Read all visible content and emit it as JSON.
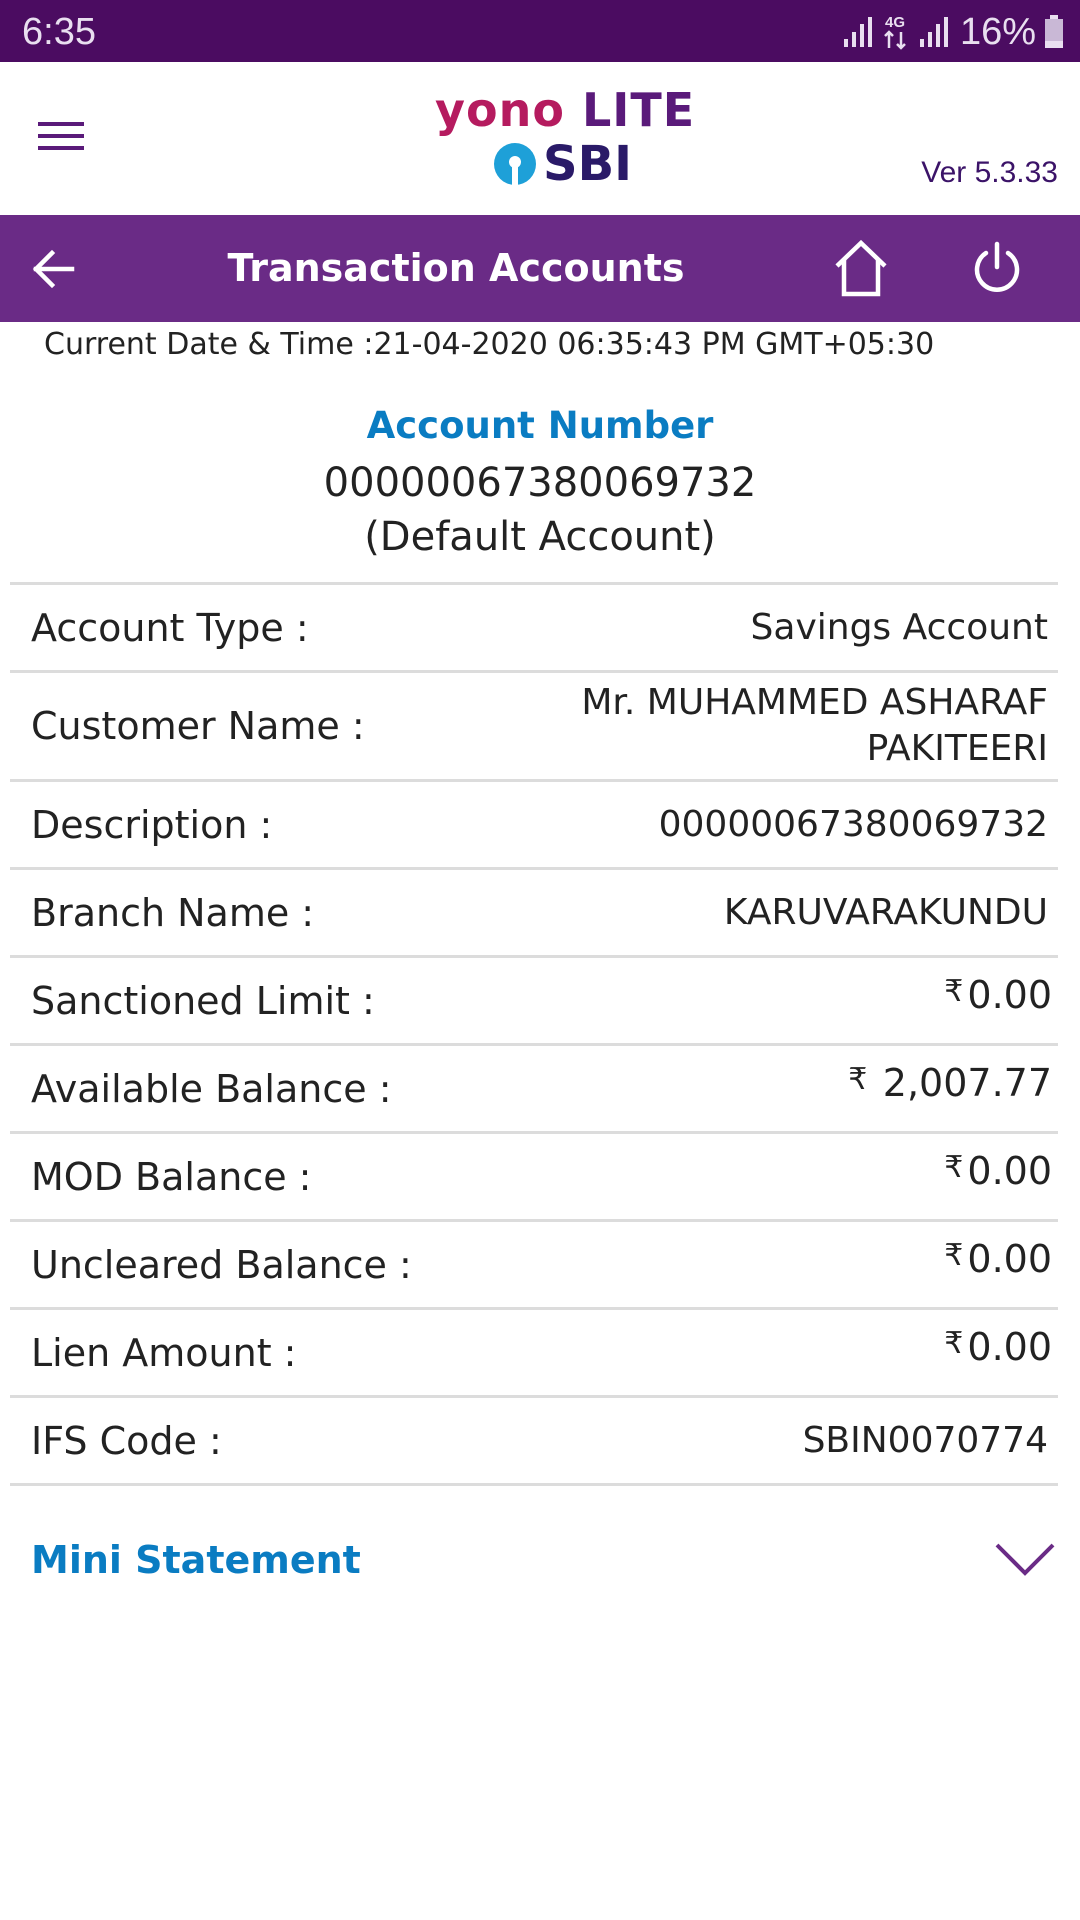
{
  "status_bar": {
    "time": "6:35",
    "network": "4G",
    "battery_percent": "16%"
  },
  "header": {
    "logo_yono": "yono",
    "logo_lite": "LITE",
    "logo_sbi": "SBI",
    "version": "Ver 5.3.33"
  },
  "nav": {
    "title": "Transaction Accounts"
  },
  "datetime": {
    "label": "Current Date & Time :",
    "value": "21-04-2020 06:35:43 PM GMT+05:30"
  },
  "account": {
    "label": "Account Number",
    "number": "00000067380069732",
    "default_note": "(Default Account)"
  },
  "details": [
    {
      "label": "Account Type :",
      "value": "Savings Account"
    },
    {
      "label": "Customer Name :",
      "value": "Mr. MUHAMMED ASHARAF PAKITEERI"
    },
    {
      "label": "Description :",
      "value": "00000067380069732"
    },
    {
      "label": "Branch Name :",
      "value": "KARUVARAKUNDU"
    },
    {
      "label": "Sanctioned Limit :",
      "currency": "₹",
      "amount": "0.00"
    },
    {
      "label": "Available Balance :",
      "currency": "₹",
      "amount": "2,007.77"
    },
    {
      "label": "MOD Balance :",
      "currency": "₹",
      "amount": "0.00"
    },
    {
      "label": "Uncleared Balance :",
      "currency": "₹",
      "amount": "0.00"
    },
    {
      "label": "Lien Amount :",
      "currency": "₹",
      "amount": "0.00"
    },
    {
      "label": "IFS Code :",
      "value": "SBIN0070774"
    }
  ],
  "mini_statement": {
    "label": "Mini Statement"
  },
  "colors": {
    "status_bar": "#4b0c61",
    "nav_bar": "#6a2b86",
    "accent_blue": "#0a7cc2",
    "logo_pink": "#b51b5f",
    "logo_purple": "#5a1a7a",
    "divider": "#dcdcdc"
  },
  "icons": {
    "menu": "hamburger-menu-icon",
    "back": "arrow-left-icon",
    "home": "home-icon",
    "power": "power-icon",
    "expand": "chevron-down-icon"
  }
}
